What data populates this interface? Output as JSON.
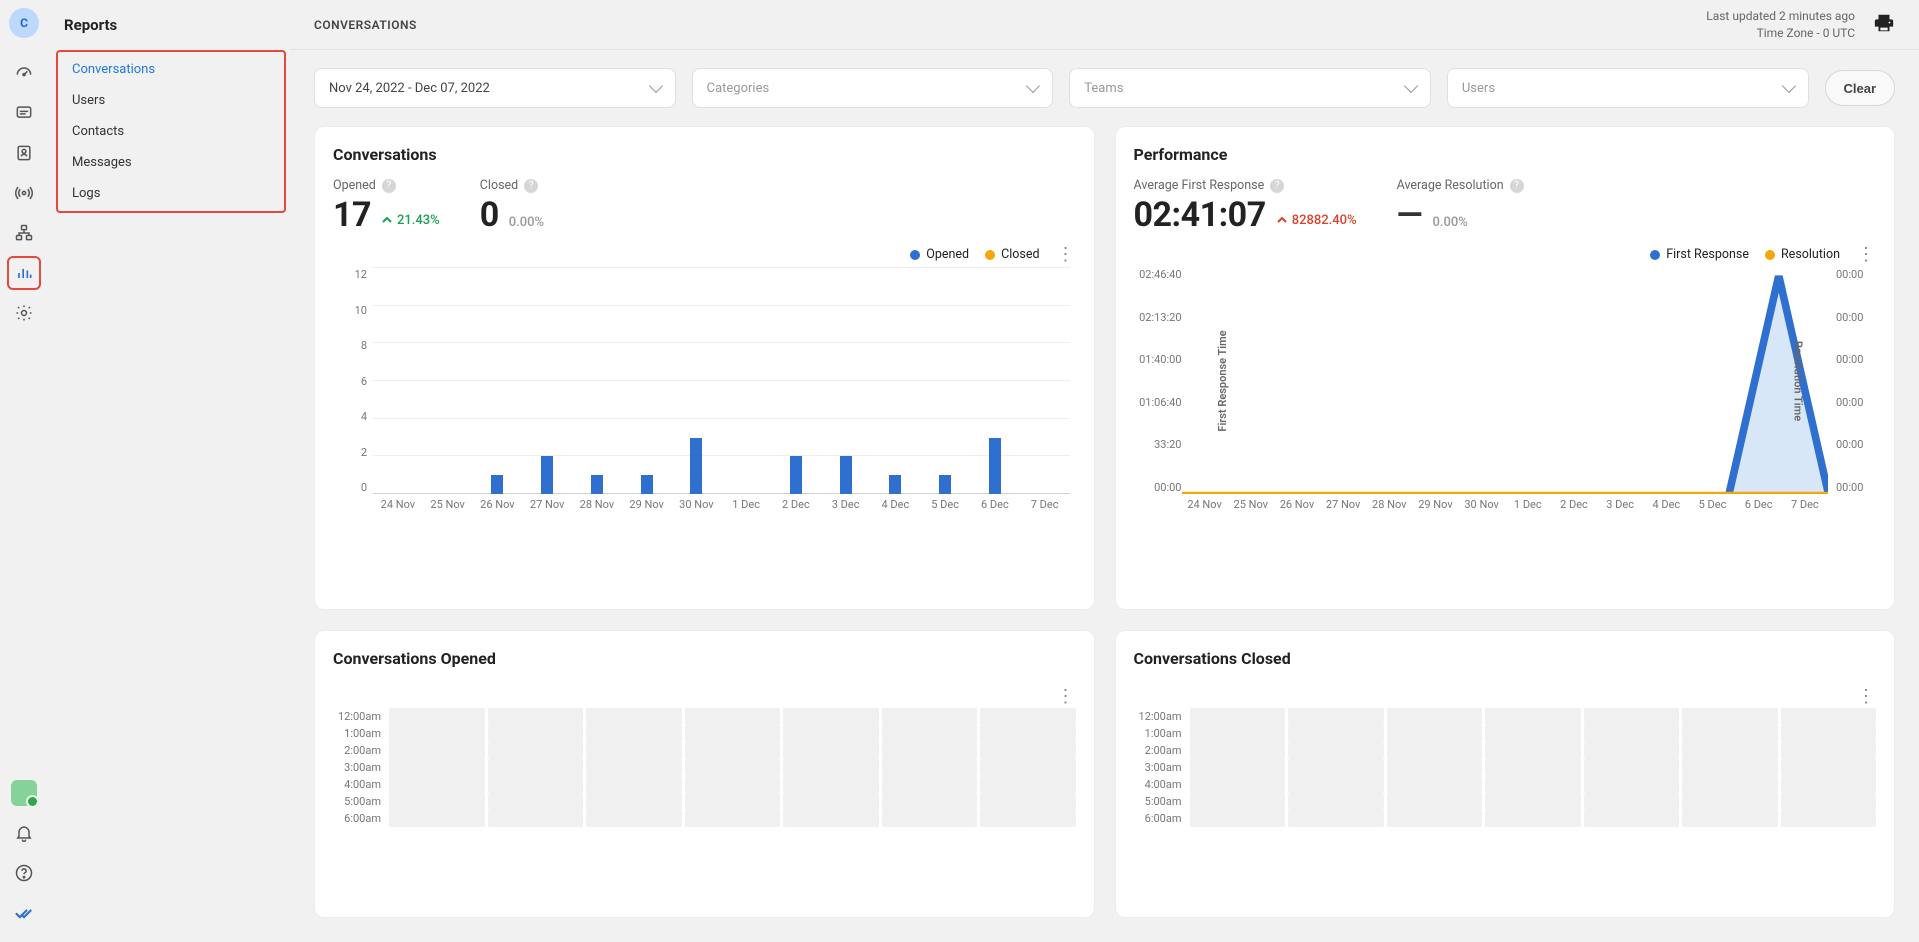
{
  "rail": {
    "avatar_letter": "C",
    "items": [
      "dashboard",
      "chat",
      "contacts-book",
      "broadcast",
      "org-tree",
      "reports-bars",
      "settings-gear"
    ],
    "active_index": 5
  },
  "sidebar": {
    "title": "Reports",
    "items": [
      "Conversations",
      "Users",
      "Contacts",
      "Messages",
      "Logs"
    ],
    "active_index": 0
  },
  "header": {
    "title": "CONVERSATIONS",
    "last_updated": "Last updated 2 minutes ago",
    "timezone": "Time Zone - 0 UTC"
  },
  "filters": {
    "date_range": "Nov 24, 2022 - Dec 07, 2022",
    "categories_placeholder": "Categories",
    "teams_placeholder": "Teams",
    "users_placeholder": "Users",
    "clear_label": "Clear"
  },
  "cards": {
    "conversations": {
      "title": "Conversations",
      "metrics": [
        {
          "label": "Opened",
          "value": "17",
          "delta": "21.43%",
          "direction": "up"
        },
        {
          "label": "Closed",
          "value": "0",
          "delta": "0.00%",
          "direction": "neutral"
        }
      ],
      "legend": [
        "Opened",
        "Closed"
      ]
    },
    "performance": {
      "title": "Performance",
      "metrics": [
        {
          "label": "Average First Response",
          "value": "02:41:07",
          "delta": "82882.40%",
          "direction": "down"
        },
        {
          "label": "Average Resolution",
          "value": "—",
          "delta": "0.00%",
          "direction": "neutral"
        }
      ],
      "legend": [
        "First Response",
        "Resolution"
      ],
      "y_left_label": "First Response Time",
      "y_right_label": "Resolution Time"
    },
    "opened_heat": {
      "title": "Conversations Opened"
    },
    "closed_heat": {
      "title": "Conversations Closed"
    }
  },
  "chart_data": [
    {
      "id": "conversations-bars",
      "type": "bar",
      "categories": [
        "24 Nov",
        "25 Nov",
        "26 Nov",
        "27 Nov",
        "28 Nov",
        "29 Nov",
        "30 Nov",
        "1 Dec",
        "2 Dec",
        "3 Dec",
        "4 Dec",
        "5 Dec",
        "6 Dec",
        "7 Dec"
      ],
      "series": [
        {
          "name": "Opened",
          "color": "#2f6fd0",
          "values": [
            0,
            0,
            1,
            2,
            1,
            1,
            3,
            0,
            2,
            2,
            1,
            1,
            3,
            0
          ]
        },
        {
          "name": "Closed",
          "color": "#f4a60b",
          "values": [
            0,
            0,
            0,
            0,
            0,
            0,
            0,
            0,
            0,
            0,
            0,
            0,
            0,
            0
          ]
        }
      ],
      "ylim": [
        0,
        12
      ],
      "yticks": [
        0,
        2,
        4,
        6,
        8,
        10,
        12
      ]
    },
    {
      "id": "performance-lines",
      "type": "line",
      "categories": [
        "24 Nov",
        "25 Nov",
        "26 Nov",
        "27 Nov",
        "28 Nov",
        "29 Nov",
        "30 Nov",
        "1 Dec",
        "2 Dec",
        "3 Dec",
        "4 Dec",
        "5 Dec",
        "6 Dec",
        "7 Dec"
      ],
      "y_left_ticks": [
        "00:00",
        "33:20",
        "01:06:40",
        "01:40:00",
        "02:13:20",
        "02:46:40"
      ],
      "y_right_ticks": [
        "00:00",
        "00:00",
        "00:00",
        "00:00",
        "00:00",
        "00:00"
      ],
      "series": [
        {
          "name": "First Response",
          "color": "#2f6fd0",
          "axis": "left",
          "values_seconds": [
            0,
            0,
            0,
            0,
            0,
            0,
            0,
            0,
            0,
            0,
            0,
            0,
            9667,
            0
          ]
        },
        {
          "name": "Resolution",
          "color": "#f4a60b",
          "axis": "right",
          "values_seconds": [
            0,
            0,
            0,
            0,
            0,
            0,
            0,
            0,
            0,
            0,
            0,
            0,
            0,
            0
          ]
        }
      ],
      "y_left_max_seconds": 10000
    },
    {
      "id": "opened-heatmap",
      "type": "heatmap",
      "row_labels": [
        "12:00am",
        "1:00am",
        "2:00am",
        "3:00am",
        "4:00am",
        "5:00am",
        "6:00am"
      ],
      "cols": 7
    },
    {
      "id": "closed-heatmap",
      "type": "heatmap",
      "row_labels": [
        "12:00am",
        "1:00am",
        "2:00am",
        "3:00am",
        "4:00am",
        "5:00am",
        "6:00am"
      ],
      "cols": 7
    }
  ]
}
